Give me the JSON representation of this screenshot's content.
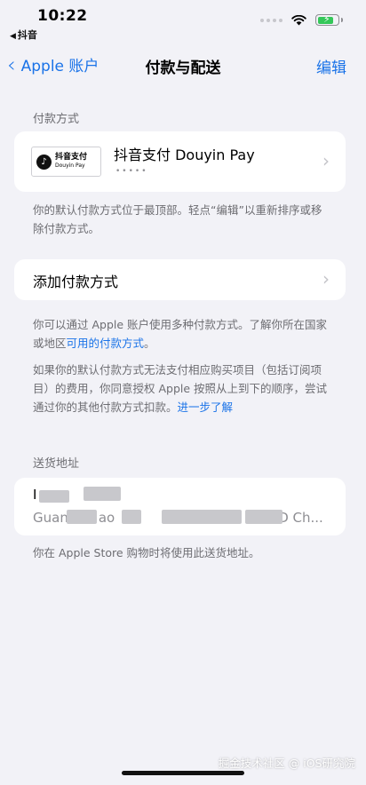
{
  "status_bar": {
    "time": "10:22",
    "back_app": "抖音"
  },
  "nav": {
    "back_label": "Apple 账户",
    "title": "付款与配送",
    "edit_label": "编辑"
  },
  "payment_section": {
    "header": "付款方式",
    "method": {
      "logo_cn": "抖音支付",
      "logo_en": "Douyin Pay",
      "name": "抖音支付 Douyin Pay",
      "masked": "•••••"
    },
    "footnote": "你的默认付款方式位于最顶部。轻点“编辑”以重新排序或移除付款方式。"
  },
  "add_payment": {
    "label": "添加付款方式",
    "note1_prefix": "你可以通过 Apple 账户使用多种付款方式。了解你所在国家或地区",
    "note1_link": "可用的付款方式",
    "note1_suffix": "。",
    "note2_prefix": "如果你的默认付款方式无法支付相应购买项目（包括订阅项目）的费用，你同意授权 Apple 按照从上到下的顺序，尝试通过你的其他付款方式扣款。",
    "note2_link": "进一步了解"
  },
  "shipping_section": {
    "header": "送货地址",
    "line1": "I",
    "line2_start": "Guan",
    "line2_mid": "ao",
    "line2_end": "D Ch...",
    "footnote": "你在 Apple Store 购物时将使用此送货地址。"
  },
  "watermark": "掘金技术社区 @ iOS研究院",
  "colors": {
    "accent": "#1a73e8",
    "background": "#f2f2f7",
    "battery": "#34c759"
  }
}
